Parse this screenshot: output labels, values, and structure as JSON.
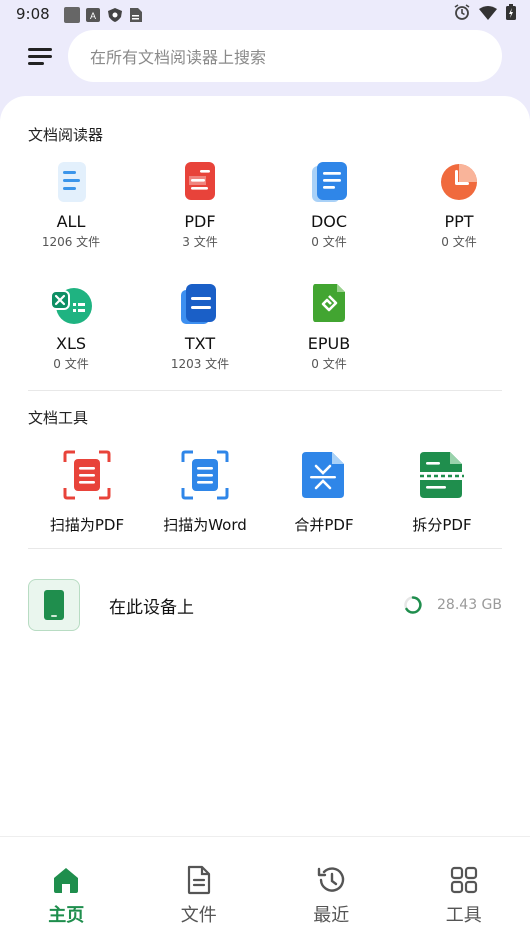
{
  "status": {
    "time": "9:08"
  },
  "search": {
    "placeholder": "在所有文档阅读器上搜索"
  },
  "reader": {
    "title": "文档阅读器",
    "items": [
      {
        "label": "ALL",
        "count": "1206 文件",
        "icon": "all-docs-icon"
      },
      {
        "label": "PDF",
        "count": "3 文件",
        "icon": "pdf-icon"
      },
      {
        "label": "DOC",
        "count": "0 文件",
        "icon": "doc-icon"
      },
      {
        "label": "PPT",
        "count": "0 文件",
        "icon": "ppt-icon"
      },
      {
        "label": "XLS",
        "count": "0 文件",
        "icon": "xls-icon"
      },
      {
        "label": "TXT",
        "count": "1203 文件",
        "icon": "txt-icon"
      },
      {
        "label": "EPUB",
        "count": "0 文件",
        "icon": "epub-icon"
      }
    ]
  },
  "tools": {
    "title": "文档工具",
    "items": [
      {
        "label": "扫描为PDF",
        "icon": "scan-to-pdf-icon"
      },
      {
        "label": "扫描为Word",
        "icon": "scan-to-word-icon"
      },
      {
        "label": "合并PDF",
        "icon": "merge-pdf-icon"
      },
      {
        "label": "拆分PDF",
        "icon": "split-pdf-icon"
      }
    ]
  },
  "device": {
    "label": "在此设备上",
    "size": "28.43 GB"
  },
  "nav": [
    {
      "label": "主页",
      "icon": "home-icon",
      "active": true
    },
    {
      "label": "文件",
      "icon": "file-icon",
      "active": false
    },
    {
      "label": "最近",
      "icon": "history-icon",
      "active": false
    },
    {
      "label": "工具",
      "icon": "grid-icon",
      "active": false
    }
  ],
  "colors": {
    "accent": "#1f8e4d",
    "pdf": "#e8433a",
    "doc": "#2f86e8",
    "ppt": "#f06a3d",
    "xls": "#1fb381",
    "txt": "#1a5fc7",
    "epub": "#42a531"
  }
}
